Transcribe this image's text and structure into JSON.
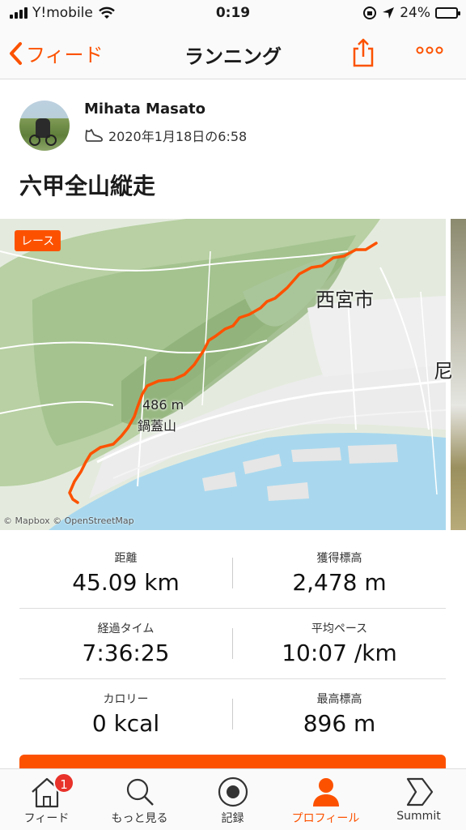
{
  "status_bar": {
    "carrier": "Y!mobile",
    "time": "0:19",
    "battery": "24%",
    "battery_level": 0.24,
    "icons": [
      "signal-icon",
      "wifi-icon",
      "rotation-lock-icon",
      "location-arrow-icon",
      "battery-icon"
    ]
  },
  "nav": {
    "back_label": "フィード",
    "title": "ランニング",
    "icons": [
      "chevron-left-icon",
      "share-icon",
      "more-icon"
    ]
  },
  "activity": {
    "athlete": "Mihata Masato",
    "datetime": "2020年1月18日の6:58",
    "title": "六甲全山縦走"
  },
  "map": {
    "badge": "レース",
    "labels": {
      "city": "西宮市",
      "partial": "尼",
      "elevation": "486 m",
      "mountain": "鍋蓋山"
    },
    "attribution": "© Mapbox © OpenStreetMap",
    "route_color": "#fc5200"
  },
  "stats": [
    {
      "left": {
        "label": "距離",
        "value": "45.09 km"
      },
      "right": {
        "label": "獲得標高",
        "value": "2,478 m"
      }
    },
    {
      "left": {
        "label": "経過タイム",
        "value": "7:36:25"
      },
      "right": {
        "label": "平均ペース",
        "value": "10:07 /km"
      }
    },
    {
      "left": {
        "label": "カロリー",
        "value": "0 kcal"
      },
      "right": {
        "label": "最高標高",
        "value": "896 m"
      }
    }
  ],
  "tabs": [
    {
      "label": "フィード",
      "icon": "home-icon",
      "badge": "1"
    },
    {
      "label": "もっと見る",
      "icon": "search-icon"
    },
    {
      "label": "記録",
      "icon": "record-icon"
    },
    {
      "label": "プロフィール",
      "icon": "profile-icon",
      "active": true
    },
    {
      "label": "Summit",
      "icon": "summit-icon"
    }
  ],
  "colors": {
    "accent": "#fc5200",
    "badge": "#e8322a"
  }
}
